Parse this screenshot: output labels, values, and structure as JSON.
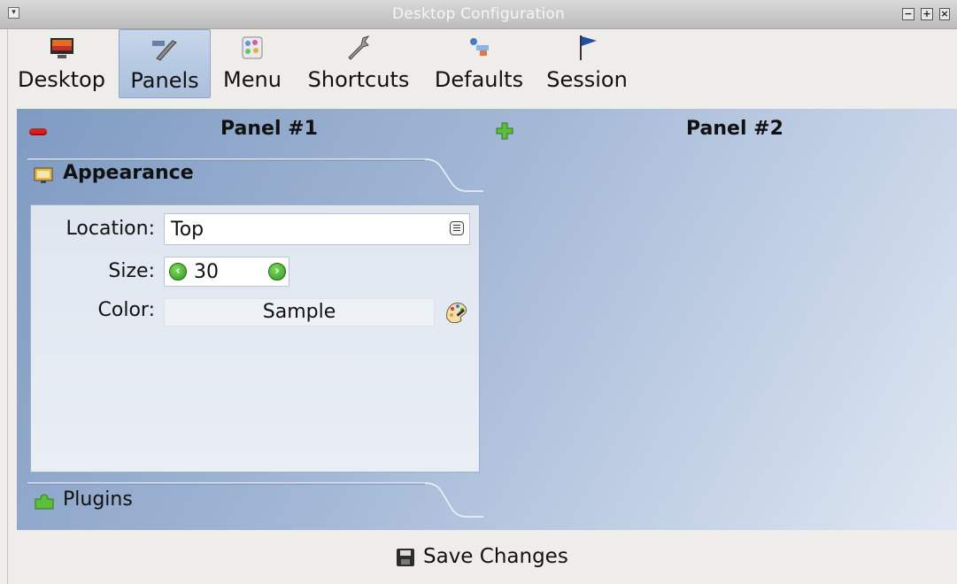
{
  "window": {
    "title": "Desktop Configuration",
    "controls": [
      "minimize-icon",
      "maximize-icon",
      "close-icon"
    ]
  },
  "toolbar": {
    "items": [
      {
        "label": "Desktop",
        "icon": "desktop-icon",
        "active": false
      },
      {
        "label": "Panels",
        "icon": "panels-icon",
        "active": true
      },
      {
        "label": "Menu",
        "icon": "menu-icon",
        "active": false
      },
      {
        "label": "Shortcuts",
        "icon": "shortcuts-icon",
        "active": false
      },
      {
        "label": "Defaults",
        "icon": "defaults-icon",
        "active": false
      },
      {
        "label": "Session",
        "icon": "session-flag-icon",
        "active": false
      }
    ]
  },
  "panels": {
    "panel1": {
      "title": "Panel #1",
      "action_icon": "remove-icon"
    },
    "panel2": {
      "title": "Panel #2",
      "action_icon": "add-icon"
    }
  },
  "appearance": {
    "tab_label": "Appearance",
    "location_label": "Location:",
    "location_value": "Top",
    "size_label": "Size:",
    "size_value": "30",
    "color_label": "Color:",
    "color_sample": "Sample"
  },
  "plugins": {
    "tab_label": "Plugins"
  },
  "footer": {
    "save_label": "Save Changes"
  },
  "colors": {
    "main_bg_start": "#7f9bc2",
    "main_bg_end": "#dfe7f2",
    "active_tab": "#a9bfdc"
  }
}
